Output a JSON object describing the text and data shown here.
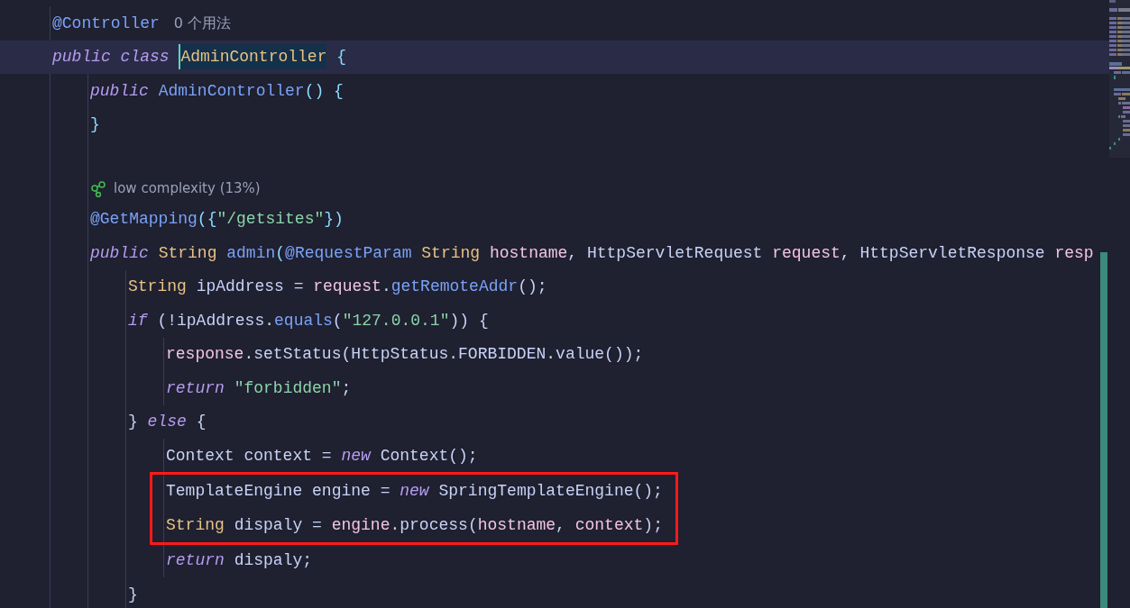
{
  "lines": [
    {
      "tokens": [
        {
          "text": "@Controller",
          "kind": "annotation"
        }
      ],
      "hint": "0 个用法"
    },
    {
      "current": true,
      "tokens": [
        {
          "text": "public class ",
          "kind": "keyword",
          "selected": false
        },
        {
          "text": "AdminController",
          "kind": "type",
          "selected": true
        },
        {
          "text": " {",
          "kind": "punct",
          "selected": false
        }
      ],
      "children": [
        {
          "tokens": [
            {
              "text": "public ",
              "kind": "keyword"
            },
            {
              "text": "AdminController",
              "kind": "method"
            },
            {
              "text": "() {",
              "kind": "punct"
            }
          ]
        },
        {
          "tokens": [
            {
              "text": "}",
              "kind": "punct"
            }
          ]
        },
        {
          "kind": "blank"
        },
        {
          "kind": "inlay",
          "text": "low complexity (13%)"
        },
        {
          "tokens": [
            {
              "text": "@GetMapping",
              "kind": "annotation"
            },
            {
              "text": "({",
              "kind": "punct"
            },
            {
              "text": "\"/getsites\"",
              "kind": "string"
            },
            {
              "text": "})",
              "kind": "punct"
            }
          ]
        },
        {
          "tokens": [
            {
              "text": "public ",
              "kind": "keyword"
            },
            {
              "text": "String ",
              "kind": "type"
            },
            {
              "text": "admin",
              "kind": "method"
            },
            {
              "text": "(",
              "kind": "punct"
            },
            {
              "text": "@RequestParam ",
              "kind": "annotation"
            },
            {
              "text": "String ",
              "kind": "type"
            },
            {
              "text": "hostname",
              "kind": "param"
            },
            {
              "text": ", HttpServletRequest ",
              "kind": "plain"
            },
            {
              "text": "request",
              "kind": "param"
            },
            {
              "text": ", HttpServletResponse ",
              "kind": "plain"
            },
            {
              "text": "resp",
              "kind": "param"
            }
          ],
          "children": [
            {
              "tokens": [
                {
                  "text": "String ",
                  "kind": "type"
                },
                {
                  "text": "ipAddress = ",
                  "kind": "plain"
                },
                {
                  "text": "request",
                  "kind": "param"
                },
                {
                  "text": ".",
                  "kind": "plain"
                },
                {
                  "text": "getRemoteAddr",
                  "kind": "method"
                },
                {
                  "text": "();",
                  "kind": "plain"
                }
              ]
            },
            {
              "tokens": [
                {
                  "text": "if ",
                  "kind": "keyword"
                },
                {
                  "text": "(!ipAddress.",
                  "kind": "plain"
                },
                {
                  "text": "equals",
                  "kind": "method"
                },
                {
                  "text": "(",
                  "kind": "plain"
                },
                {
                  "text": "\"127.0.0.1\"",
                  "kind": "string"
                },
                {
                  "text": ")) {",
                  "kind": "plain"
                }
              ],
              "children": [
                {
                  "tokens": [
                    {
                      "text": "response",
                      "kind": "param"
                    },
                    {
                      "text": ".setStatus(HttpStatus.FORBIDDEN.value());",
                      "kind": "plain"
                    }
                  ]
                },
                {
                  "tokens": [
                    {
                      "text": "return ",
                      "kind": "keyword"
                    },
                    {
                      "text": "\"forbidden\"",
                      "kind": "string"
                    },
                    {
                      "text": ";",
                      "kind": "plain"
                    }
                  ]
                }
              ]
            },
            {
              "tokens": [
                {
                  "text": "} ",
                  "kind": "plain"
                },
                {
                  "text": "else ",
                  "kind": "keyword"
                },
                {
                  "text": "{",
                  "kind": "plain"
                }
              ],
              "children": [
                {
                  "tokens": [
                    {
                      "text": "Context context = ",
                      "kind": "plain"
                    },
                    {
                      "text": "new ",
                      "kind": "keyword"
                    },
                    {
                      "text": "Context();",
                      "kind": "plain"
                    }
                  ]
                },
                {
                  "boxed": true,
                  "tokens": [
                    {
                      "text": "TemplateEngine engine = ",
                      "kind": "plain"
                    },
                    {
                      "text": "new ",
                      "kind": "keyword"
                    },
                    {
                      "text": "SpringTemplateEngine();",
                      "kind": "plain"
                    }
                  ]
                },
                {
                  "boxed": true,
                  "tokens": [
                    {
                      "text": "String ",
                      "kind": "type"
                    },
                    {
                      "text": "dispaly = ",
                      "kind": "plain"
                    },
                    {
                      "text": "engine",
                      "kind": "param"
                    },
                    {
                      "text": ".process(",
                      "kind": "plain"
                    },
                    {
                      "text": "hostname",
                      "kind": "param"
                    },
                    {
                      "text": ", ",
                      "kind": "plain"
                    },
                    {
                      "text": "context",
                      "kind": "param"
                    },
                    {
                      "text": ");",
                      "kind": "plain"
                    }
                  ]
                },
                {
                  "tokens": [
                    {
                      "text": "return ",
                      "kind": "keyword"
                    },
                    {
                      "text": "dispaly;",
                      "kind": "plain"
                    }
                  ]
                }
              ]
            },
            {
              "tokens": [
                {
                  "text": "}",
                  "kind": "plain"
                }
              ]
            }
          ]
        }
      ]
    }
  ]
}
